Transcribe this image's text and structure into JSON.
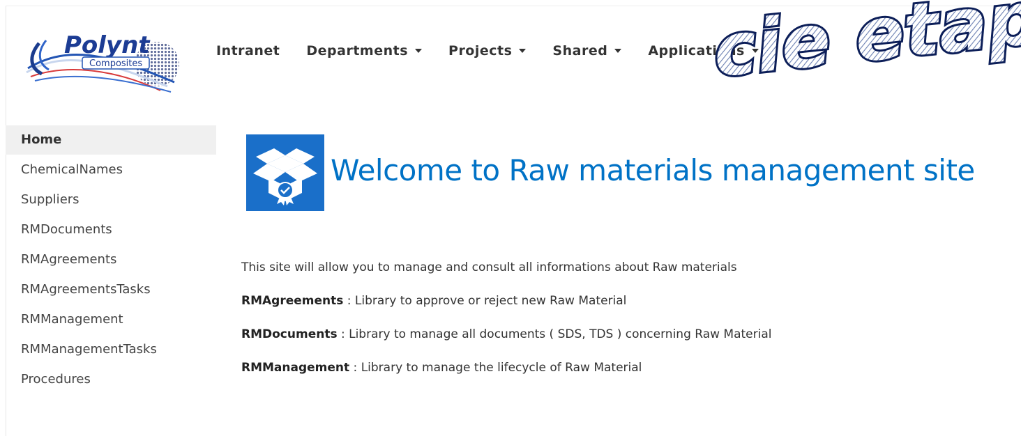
{
  "header": {
    "logo": {
      "name": "Polynt",
      "sub": "Composites"
    },
    "nav": [
      {
        "label": "Intranet",
        "dropdown": false
      },
      {
        "label": "Departments",
        "dropdown": true
      },
      {
        "label": "Projects",
        "dropdown": true
      },
      {
        "label": "Shared",
        "dropdown": true
      },
      {
        "label": "Applications",
        "dropdown": true
      }
    ],
    "watermark_text": "cie etap"
  },
  "sidebar": {
    "items": [
      {
        "label": "Home",
        "active": true
      },
      {
        "label": "ChemicalNames"
      },
      {
        "label": "Suppliers"
      },
      {
        "label": "RMDocuments"
      },
      {
        "label": "RMAgreements"
      },
      {
        "label": "RMAgreementsTasks"
      },
      {
        "label": "RMManagement"
      },
      {
        "label": "RMManagementTasks"
      },
      {
        "label": "Procedures"
      }
    ]
  },
  "main": {
    "title": "Welcome to Raw materials management site",
    "intro": "This site will allow you to manage and consult all informations about Raw materials",
    "libraries": [
      {
        "name": "RMAgreements",
        "desc": " : Library to approve or reject new Raw Material"
      },
      {
        "name": "RMDocuments",
        "desc": " : Library to manage all documents ( SDS, TDS ) concerning Raw Material"
      },
      {
        "name": "RMManagement",
        "desc": " : Library to manage the lifecycle of Raw Material"
      }
    ]
  },
  "colors": {
    "accent": "#0072c6",
    "sidebar_active": "#f0f0f0",
    "icon_bg": "#1a6fc9"
  }
}
